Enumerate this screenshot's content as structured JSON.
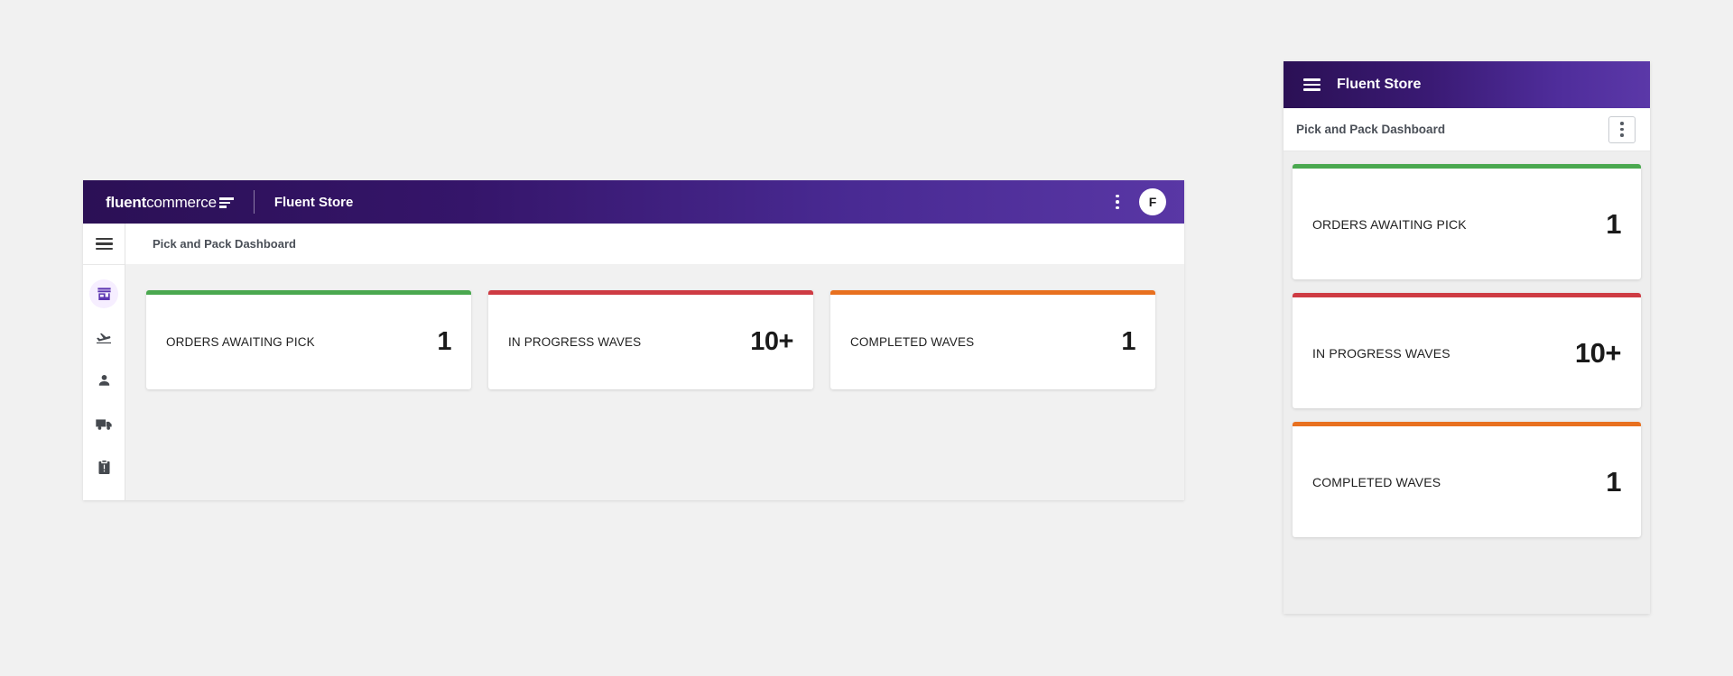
{
  "accents": {
    "green": "#4aa84f",
    "red": "#ce3b43",
    "orange": "#e8701f",
    "purple_dark": "#2b1055",
    "purple_light": "#5b38a8",
    "active_icon": "#5c35b0"
  },
  "desktop": {
    "appbar": {
      "logo_bold": "fluent",
      "logo_light": "commerce",
      "logo_mark_icon": "three-bar-mark-icon",
      "title": "Fluent Store",
      "menu_icon": "kebab-menu-icon",
      "avatar_initial": "F"
    },
    "rail": {
      "menu_icon": "hamburger-icon",
      "items": [
        {
          "icon": "store-icon",
          "label": "Store",
          "active": true
        },
        {
          "icon": "plane-landing-icon",
          "label": "Inbound",
          "active": false
        },
        {
          "icon": "person-icon",
          "label": "Customers",
          "active": false
        },
        {
          "icon": "truck-icon",
          "label": "Shipments",
          "active": false
        },
        {
          "icon": "clipboard-alert-icon",
          "label": "Tasks",
          "active": false
        }
      ]
    },
    "breadcrumb": "Pick and Pack Dashboard",
    "cards": [
      {
        "label": "ORDERS AWAITING PICK",
        "value": "1",
        "accent": "#4aa84f"
      },
      {
        "label": "IN PROGRESS WAVES",
        "value": "10+",
        "accent": "#ce3b43"
      },
      {
        "label": "COMPLETED WAVES",
        "value": "1",
        "accent": "#e8701f"
      }
    ]
  },
  "mobile": {
    "appbar": {
      "menu_icon": "hamburger-icon",
      "title": "Fluent Store"
    },
    "subbar": {
      "title": "Pick and Pack Dashboard",
      "menu_icon": "kebab-menu-icon"
    },
    "cards": [
      {
        "label": "ORDERS AWAITING PICK",
        "value": "1",
        "accent": "#4aa84f"
      },
      {
        "label": "IN PROGRESS WAVES",
        "value": "10+",
        "accent": "#ce3b43"
      },
      {
        "label": "COMPLETED WAVES",
        "value": "1",
        "accent": "#e8701f"
      }
    ]
  }
}
